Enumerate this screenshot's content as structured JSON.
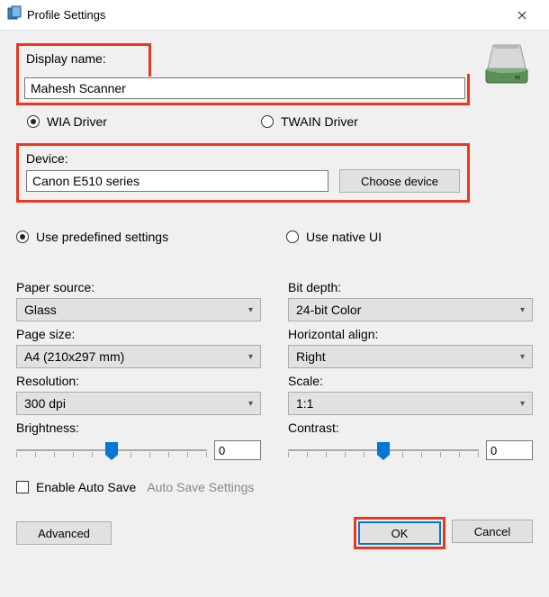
{
  "titlebar": {
    "title": "Profile Settings"
  },
  "displayName": {
    "label": "Display name:",
    "value": "Mahesh Scanner"
  },
  "driver": {
    "wia": "WIA Driver",
    "twain": "TWAIN Driver",
    "selected": "wia"
  },
  "device": {
    "label": "Device:",
    "value": "Canon E510 series",
    "choose_label": "Choose device"
  },
  "settingsMode": {
    "predef": "Use predefined settings",
    "native": "Use native UI",
    "selected": "predef"
  },
  "left": {
    "paperSource": {
      "label": "Paper source:",
      "value": "Glass"
    },
    "pageSize": {
      "label": "Page size:",
      "value": "A4 (210x297 mm)"
    },
    "resolution": {
      "label": "Resolution:",
      "value": "300 dpi"
    },
    "brightness": {
      "label": "Brightness:",
      "value": "0"
    }
  },
  "right": {
    "bitDepth": {
      "label": "Bit depth:",
      "value": "24-bit Color"
    },
    "hAlign": {
      "label": "Horizontal align:",
      "value": "Right"
    },
    "scale": {
      "label": "Scale:",
      "value": "1:1"
    },
    "contrast": {
      "label": "Contrast:",
      "value": "0"
    }
  },
  "autoSave": {
    "enable_label": "Enable Auto Save",
    "settings_label": "Auto Save Settings",
    "checked": false
  },
  "footer": {
    "advanced": "Advanced",
    "ok": "OK",
    "cancel": "Cancel"
  }
}
